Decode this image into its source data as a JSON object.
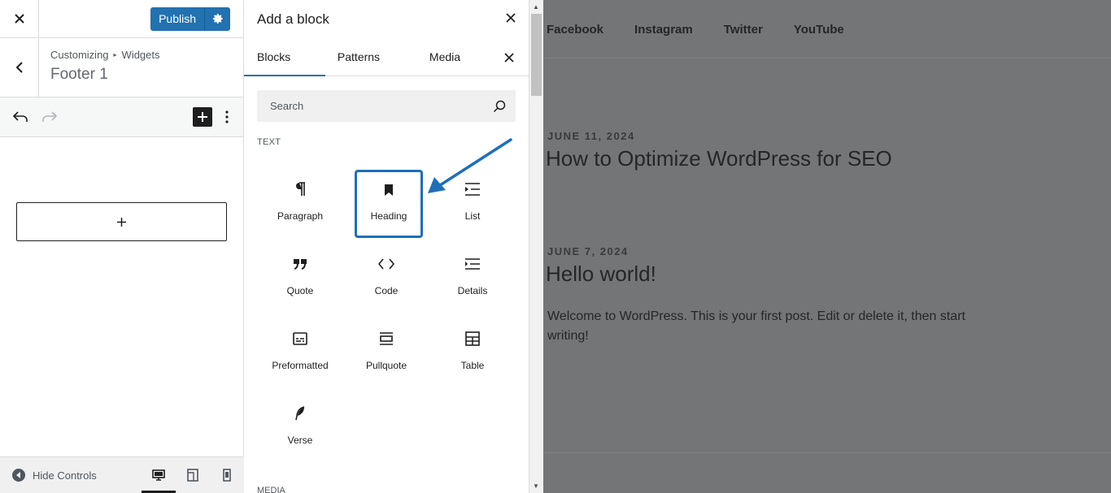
{
  "customizer": {
    "publish_label": "Publish",
    "breadcrumb": [
      "Customizing",
      "Widgets"
    ],
    "section_title": "Footer 1",
    "hide_controls_label": "Hide Controls"
  },
  "inserter": {
    "title": "Add a block",
    "tabs": [
      "Blocks",
      "Patterns",
      "Media"
    ],
    "search_placeholder": "Search",
    "category_text": "TEXT",
    "category_media": "MEDIA",
    "blocks": [
      {
        "label": "Paragraph",
        "icon": "paragraph-icon"
      },
      {
        "label": "Heading",
        "icon": "heading-icon"
      },
      {
        "label": "List",
        "icon": "list-icon"
      },
      {
        "label": "Quote",
        "icon": "quote-icon"
      },
      {
        "label": "Code",
        "icon": "code-icon"
      },
      {
        "label": "Details",
        "icon": "details-icon"
      },
      {
        "label": "Preformatted",
        "icon": "preformatted-icon"
      },
      {
        "label": "Pullquote",
        "icon": "pullquote-icon"
      },
      {
        "label": "Table",
        "icon": "table-icon"
      },
      {
        "label": "Verse",
        "icon": "verse-icon"
      }
    ]
  },
  "preview": {
    "nav": [
      "Facebook",
      "Instagram",
      "Twitter",
      "YouTube"
    ],
    "posts": [
      {
        "date": "JUNE 11, 2024",
        "title": "How to Optimize WordPress for SEO"
      },
      {
        "date": "JUNE 7, 2024",
        "title": "Hello world!",
        "excerpt": "Welcome to WordPress. This is your first post. Edit or delete it, then start writing!"
      }
    ]
  },
  "colors": {
    "accent": "#2271b1",
    "highlight": "#1e6fb8",
    "overlay": "#747577"
  }
}
